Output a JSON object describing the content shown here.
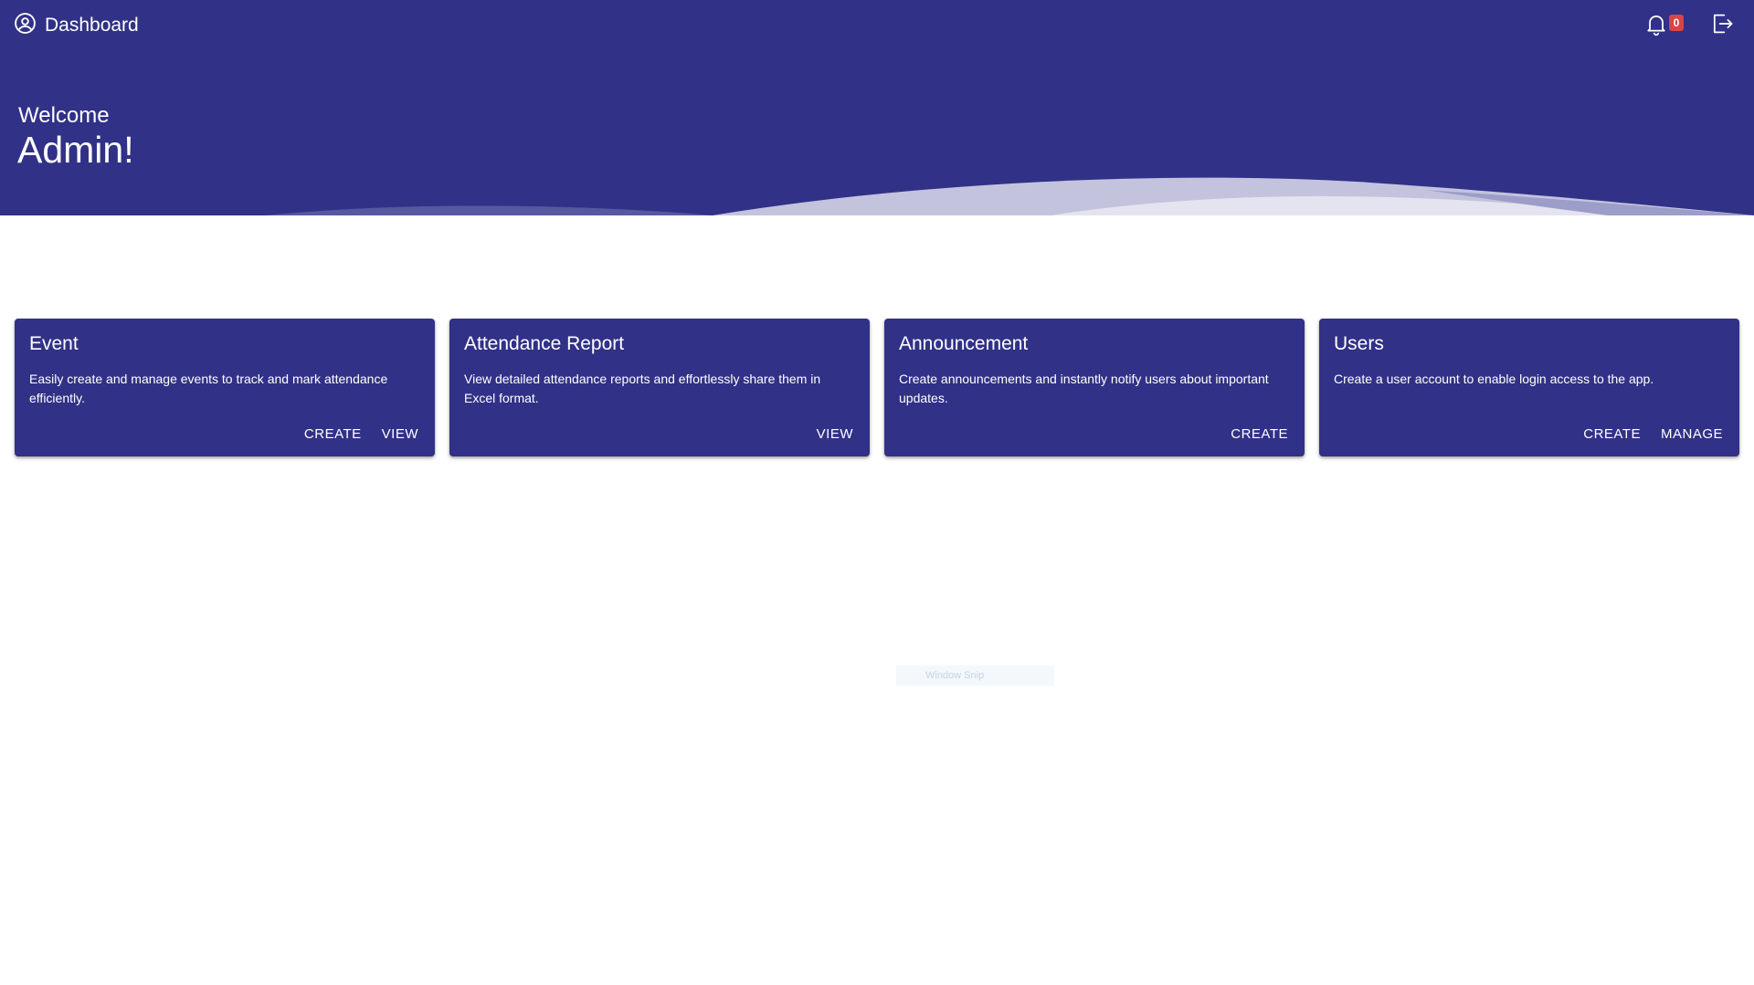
{
  "header": {
    "title": "Dashboard",
    "notification_count": "0",
    "welcome": "Welcome",
    "user_name": "Admin!"
  },
  "cards": [
    {
      "title": "Event",
      "description": "Easily create and manage events to track and mark attendance efficiently.",
      "actions": [
        "CREATE",
        "VIEW"
      ]
    },
    {
      "title": "Attendance Report",
      "description": "View detailed attendance reports and effortlessly share them in Excel format.",
      "actions": [
        "VIEW"
      ]
    },
    {
      "title": "Announcement",
      "description": "Create announcements and instantly notify users about important updates.",
      "actions": [
        "CREATE"
      ]
    },
    {
      "title": "Users",
      "description": "Create a user account to enable login access to the app.",
      "actions": [
        "CREATE",
        "MANAGE"
      ]
    }
  ],
  "overlay": {
    "snip_label": "Window Snip"
  },
  "icons": {
    "brand": "account-circle-icon",
    "notifications": "bell-icon",
    "logout": "logout-icon"
  },
  "colors": {
    "primary": "#313187",
    "badge": "#d94444",
    "background": "#ffffff"
  }
}
